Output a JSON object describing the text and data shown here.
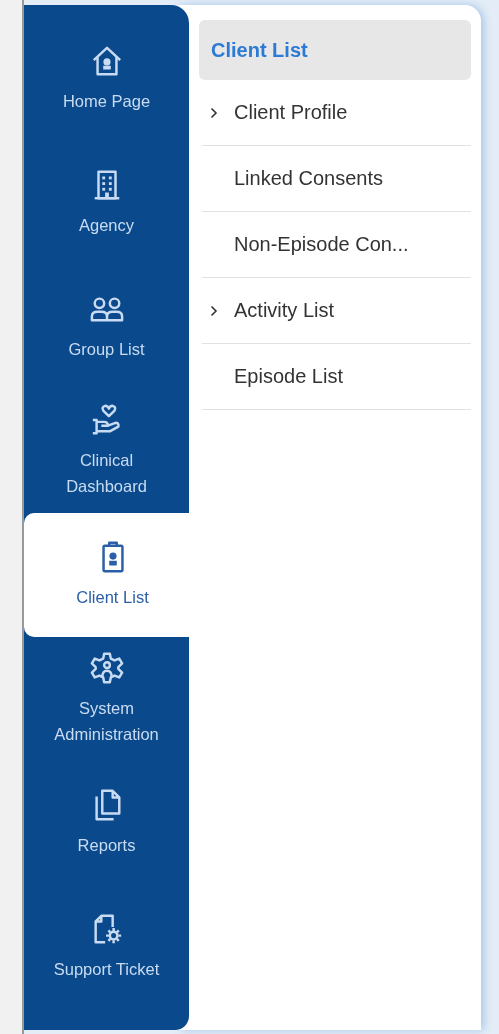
{
  "sidebar": {
    "items": [
      {
        "label": "Home Page",
        "selected": false
      },
      {
        "label": "Agency",
        "selected": false
      },
      {
        "label": "Group List",
        "selected": false
      },
      {
        "label": "Clinical Dashboard",
        "selected": false
      },
      {
        "label": "Client List",
        "selected": true
      },
      {
        "label": "System Administration",
        "selected": false
      },
      {
        "label": "Reports",
        "selected": false
      },
      {
        "label": "Support Ticket",
        "selected": false
      }
    ]
  },
  "submenu": {
    "title": "Client List",
    "title_selected": true,
    "items": [
      {
        "label": "Client Profile",
        "expandable": true
      },
      {
        "label": "Linked Consents",
        "expandable": false
      },
      {
        "label": "Non-Episode Con...",
        "expandable": false
      },
      {
        "label": "Activity List",
        "expandable": true
      },
      {
        "label": "Episode List",
        "expandable": false
      }
    ]
  }
}
